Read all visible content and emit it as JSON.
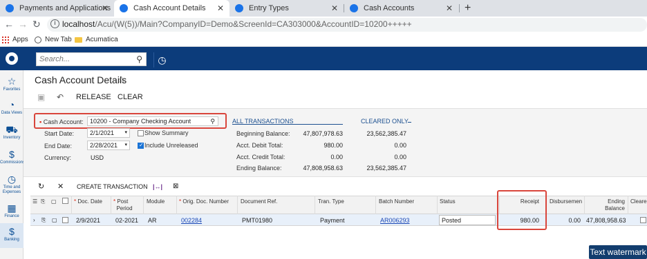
{
  "browser": {
    "tabs": [
      {
        "label": "Payments and Applications"
      },
      {
        "label": "Cash Account Details"
      },
      {
        "label": "Entry Types"
      },
      {
        "label": "Cash Accounts"
      }
    ],
    "new_tab": "+",
    "url_host": "localhost",
    "url_path": "/Acu/(W(5))/Main?CompanyID=Demo&ScreenId=CA303000&AccountID=10200+++++",
    "bookmarks": [
      {
        "label": "Apps"
      },
      {
        "label": "New Tab"
      },
      {
        "label": "Acumatica"
      }
    ]
  },
  "app": {
    "search_placeholder": "Search...",
    "nav": [
      {
        "label": "Favorites",
        "icon": "☆"
      },
      {
        "label": "Data Views",
        "icon": "◔"
      },
      {
        "label": "Inventory",
        "icon": "⛟"
      },
      {
        "label": "Commissions",
        "icon": "$"
      },
      {
        "label": "Time and Expenses",
        "icon": "◷"
      },
      {
        "label": "Finance",
        "icon": "▦"
      },
      {
        "label": "Banking",
        "icon": "$"
      }
    ]
  },
  "page": {
    "title": "Cash Account Details",
    "toolbar": {
      "release": "RELEASE",
      "clear": "CLEAR"
    },
    "form": {
      "cash_account_label": "Cash Account:",
      "cash_account_value": "10200 - Company Checking Account",
      "start_date_label": "Start Date:",
      "start_date_value": "2/1/2021",
      "end_date_label": "End Date:",
      "end_date_value": "2/28/2021",
      "currency_label": "Currency:",
      "currency_value": "USD",
      "show_summary_label": "Show Summary",
      "show_summary_checked": false,
      "include_unreleased_label": "Include Unreleased",
      "include_unreleased_checked": true
    },
    "balances": {
      "all_header": "ALL TRANSACTIONS",
      "cleared_header": "CLEARED ONLY",
      "rows": [
        {
          "label": "Beginning Balance:",
          "all": "47,807,978.63",
          "cleared": "23,562,385.47"
        },
        {
          "label": "Acct. Debit Total:",
          "all": "980.00",
          "cleared": "0.00"
        },
        {
          "label": "Acct. Credit Total:",
          "all": "0.00",
          "cleared": "0.00"
        },
        {
          "label": "Ending Balance:",
          "all": "47,808,958.63",
          "cleared": "23,562,385.47"
        }
      ]
    },
    "grid_toolbar": {
      "create_transaction": "CREATE TRANSACTION"
    },
    "grid": {
      "headers": {
        "doc_date": "Doc. Date",
        "post_period_1": "Post",
        "post_period_2": "Period",
        "module": "Module",
        "orig_doc": "Orig. Doc. Number",
        "doc_ref": "Document Ref.",
        "tran_type": "Tran. Type",
        "batch": "Batch Number",
        "status": "Status",
        "receipt": "Receipt",
        "disbursement": "Disbursemen",
        "ending_1": "Ending",
        "ending_2": "Balance",
        "cleared": "Cleare"
      },
      "rows": [
        {
          "doc_date": "2/9/2021",
          "post_period": "02-2021",
          "module": "AR",
          "orig_doc": "002284",
          "doc_ref": "PMT01980",
          "tran_type": "Payment",
          "batch": "AR006293",
          "status": "Posted",
          "receipt": "980.00",
          "disbursement": "0.00",
          "ending_balance": "47,808,958.63"
        }
      ]
    },
    "watermark": "Text watermark"
  }
}
